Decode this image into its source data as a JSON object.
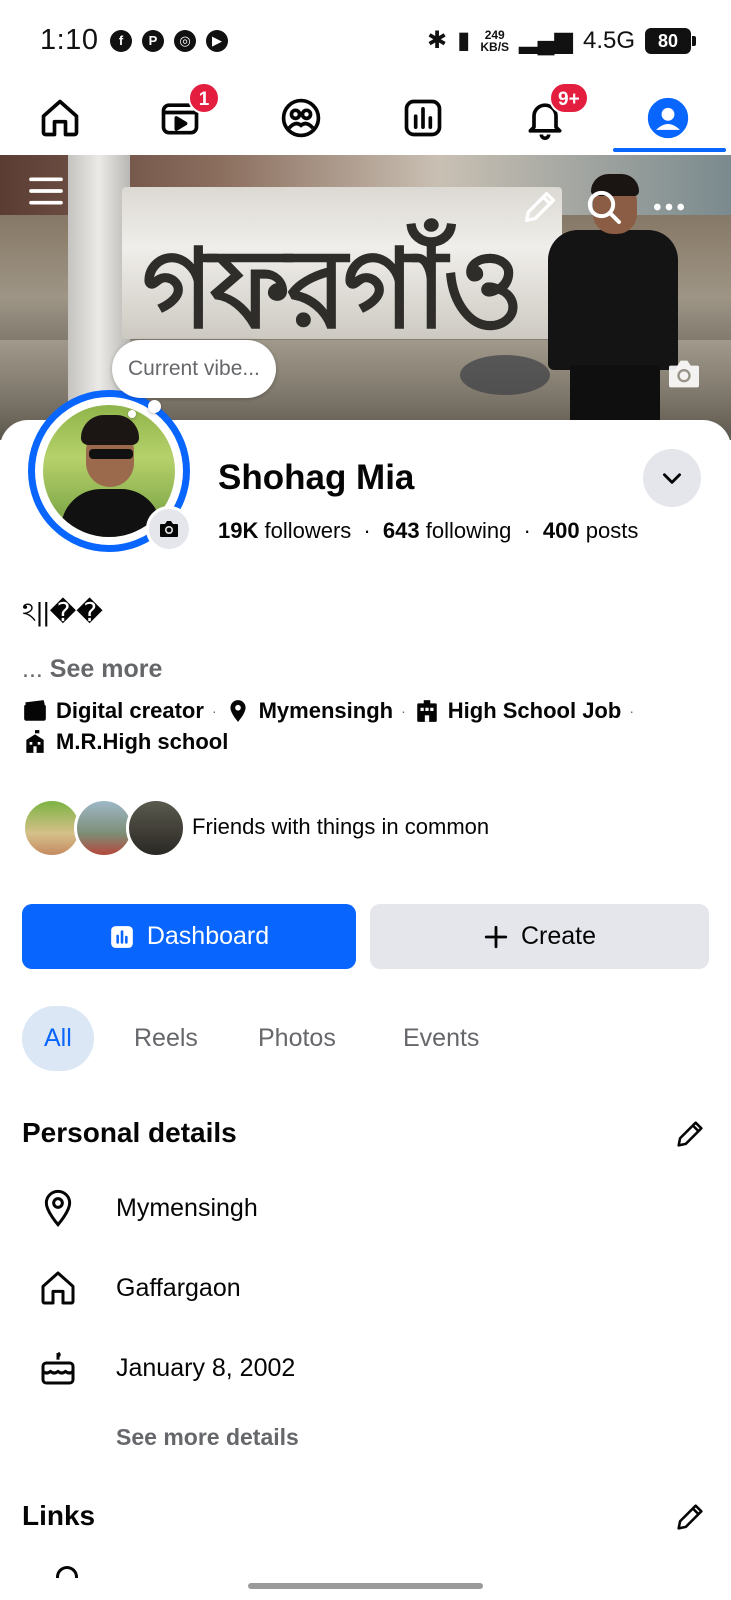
{
  "status_bar": {
    "time": "1:10",
    "app_icons": [
      "facebook-icon",
      "pay-icon",
      "chrome-icon",
      "youtube-icon"
    ],
    "net_speed_value": "249",
    "net_speed_unit": "KB/S",
    "network": "4.5G",
    "battery": "80"
  },
  "tabs": [
    {
      "name": "home",
      "icon": "home-icon",
      "badge": ""
    },
    {
      "name": "video",
      "icon": "video-icon",
      "badge": "1"
    },
    {
      "name": "friends",
      "icon": "friends-icon",
      "badge": ""
    },
    {
      "name": "dashboard",
      "icon": "dashboard-icon",
      "badge": ""
    },
    {
      "name": "notifications",
      "icon": "bell-icon",
      "badge": "9+"
    },
    {
      "name": "profile",
      "icon": "profile-icon",
      "badge": ""
    }
  ],
  "cover": {
    "sign_text": "গফরগাঁও"
  },
  "profile": {
    "current_vibe_placeholder": "Current vibe...",
    "name": "Shohag Mia",
    "followers_count": "19K",
    "followers_label": "followers",
    "following_count": "643",
    "following_label": "following",
    "posts_count": "400",
    "posts_label": "posts",
    "stats_separator": "·",
    "bio": "ঽ||��",
    "see_more_prefix": "...",
    "see_more_label": "See more"
  },
  "info": {
    "category": "Digital creator",
    "location": "Mymensingh",
    "work": "High School Job",
    "education": "M.R.High school",
    "separator": "·"
  },
  "friends_text": "Friends with things in common",
  "buttons": {
    "dashboard": "Dashboard",
    "create": "Create"
  },
  "filter_tabs": [
    "All",
    "Reels",
    "Photos",
    "Events"
  ],
  "personal_details": {
    "title": "Personal details",
    "items": [
      {
        "icon": "location-pin-icon",
        "text": "Mymensingh"
      },
      {
        "icon": "home-outline-icon",
        "text": "Gaffargaon"
      },
      {
        "icon": "birthday-cake-icon",
        "text": "January 8, 2002"
      }
    ],
    "see_more": "See more details"
  },
  "links": {
    "title": "Links"
  },
  "colors": {
    "accent": "#0866ff",
    "badge": "#e41e3f",
    "secondary_text": "#65676b",
    "button_secondary": "#e4e6eb",
    "active_tab_bg": "#dbe7f5"
  }
}
